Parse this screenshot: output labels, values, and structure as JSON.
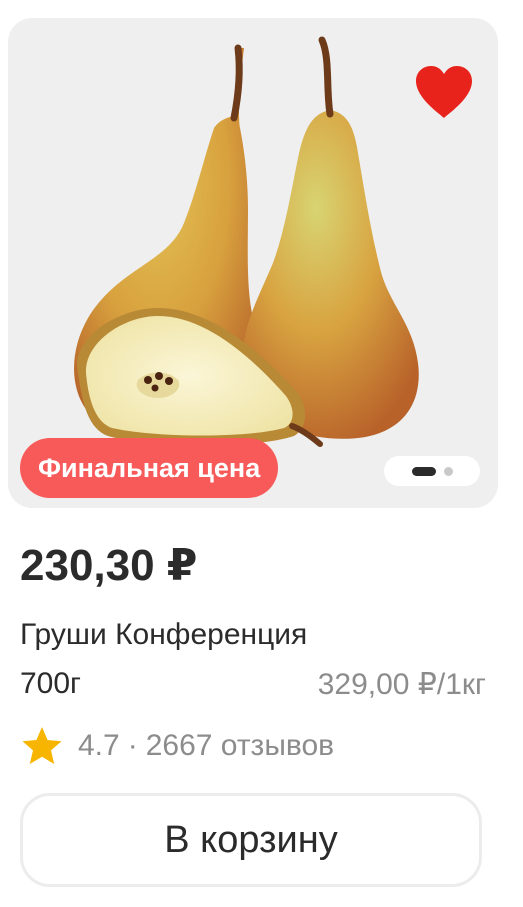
{
  "product": {
    "badge": "Финальная цена",
    "price": "230,30 ₽",
    "name": "Груши Конференция",
    "weight": "700г",
    "unit_price": "329,00 ₽/1кг",
    "rating": "4.7",
    "rating_separator": "·",
    "reviews": "2667 отзывов",
    "cart_button_label": "В корзину",
    "favorite_icon": "heart-icon",
    "rating_icon": "star-icon",
    "image_carousel": {
      "slides": 2,
      "active_slide": 1
    },
    "colors": {
      "badge": "#f85a5a",
      "heart": "#e8231c",
      "star": "#f7b500",
      "card_background": "#efefef"
    }
  }
}
